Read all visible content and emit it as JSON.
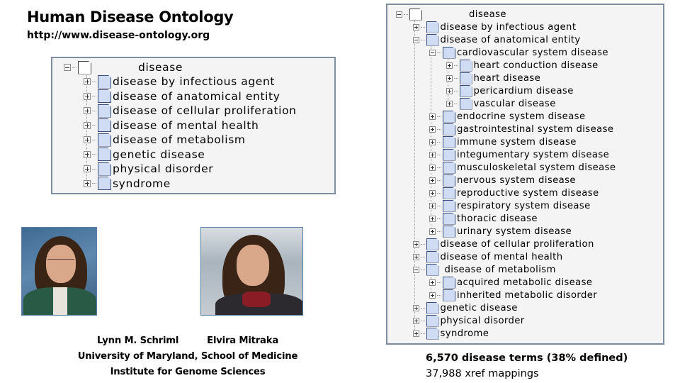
{
  "header": {
    "title": "Human Disease Ontology",
    "url": "http://www.disease-ontology.org"
  },
  "icons": {
    "toggle_expanded": "minus-box-icon",
    "toggle_collapsed": "plus-box-icon",
    "term": "document-icon"
  },
  "colors": {
    "tree_border": "#7e8ea0",
    "tree_background": "#f4f4f4",
    "doc_icon_fill": "#cfdcf3"
  },
  "tree_small": {
    "root": {
      "label": "disease",
      "expanded": true
    },
    "children": [
      {
        "label": "disease by infectious agent",
        "expanded": false
      },
      {
        "label": "disease of anatomical entity",
        "expanded": false
      },
      {
        "label": "disease of cellular proliferation",
        "expanded": false
      },
      {
        "label": "disease of mental health",
        "expanded": false
      },
      {
        "label": "disease of metabolism",
        "expanded": false
      },
      {
        "label": "genetic disease",
        "expanded": false
      },
      {
        "label": "physical disorder",
        "expanded": false
      },
      {
        "label": "syndrome",
        "expanded": false
      }
    ]
  },
  "tree_large": {
    "nodes": [
      {
        "label": "disease",
        "depth": 0,
        "expanded": true
      },
      {
        "label": "disease by infectious agent",
        "depth": 1,
        "expanded": false
      },
      {
        "label": "disease of anatomical entity",
        "depth": 1,
        "expanded": true
      },
      {
        "label": "cardiovascular system disease",
        "depth": 2,
        "expanded": true
      },
      {
        "label": "heart conduction disease",
        "depth": 3,
        "expanded": false
      },
      {
        "label": "heart disease",
        "depth": 3,
        "expanded": false
      },
      {
        "label": "pericardium disease",
        "depth": 3,
        "expanded": false
      },
      {
        "label": "vascular disease",
        "depth": 3,
        "expanded": false
      },
      {
        "label": "endocrine system disease",
        "depth": 2,
        "expanded": false
      },
      {
        "label": "gastrointestinal system disease",
        "depth": 2,
        "expanded": false
      },
      {
        "label": "immune system disease",
        "depth": 2,
        "expanded": false
      },
      {
        "label": "integumentary system disease",
        "depth": 2,
        "expanded": false
      },
      {
        "label": "musculoskeletal system disease",
        "depth": 2,
        "expanded": false
      },
      {
        "label": "nervous system disease",
        "depth": 2,
        "expanded": false
      },
      {
        "label": "reproductive system disease",
        "depth": 2,
        "expanded": false
      },
      {
        "label": "respiratory system disease",
        "depth": 2,
        "expanded": false
      },
      {
        "label": "thoracic disease",
        "depth": 2,
        "expanded": false
      },
      {
        "label": "urinary system disease",
        "depth": 2,
        "expanded": false
      },
      {
        "label": "disease of cellular proliferation",
        "depth": 1,
        "expanded": false
      },
      {
        "label": "disease of mental health",
        "depth": 1,
        "expanded": false
      },
      {
        "label": "disease of metabolism",
        "depth": 1,
        "expanded": true
      },
      {
        "label": "acquired metabolic disease",
        "depth": 2,
        "expanded": false
      },
      {
        "label": "inherited metabolic disorder",
        "depth": 2,
        "expanded": false
      },
      {
        "label": "genetic disease",
        "depth": 1,
        "expanded": false
      },
      {
        "label": "physical disorder",
        "depth": 1,
        "expanded": false
      },
      {
        "label": "syndrome",
        "depth": 1,
        "expanded": false
      }
    ]
  },
  "people": {
    "person1": {
      "name": "Lynn M. Schriml",
      "photo_alt": "Photo of Lynn M. Schriml"
    },
    "person2": {
      "name": "Elvira Mitraka",
      "photo_alt": "Photo of Elvira Mitraka"
    },
    "affiliation": "University of Maryland, School of Medicine",
    "institute": "Institute for Genome Sciences"
  },
  "stats": {
    "terms": "6,570 disease terms (38% defined)",
    "xrefs": "37,988 xref mappings"
  }
}
